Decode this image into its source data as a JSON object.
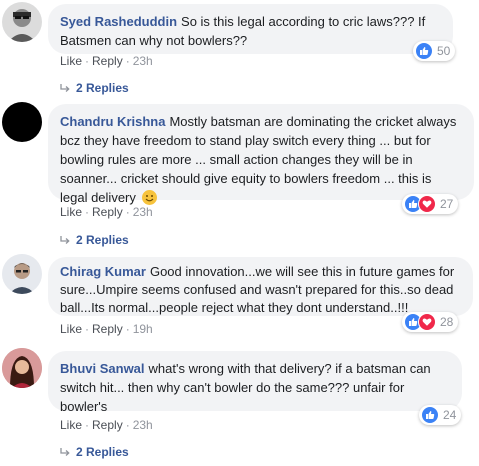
{
  "comments": [
    {
      "author": "Syed Rasheduddin",
      "text": "So is this legal according to cric laws??? If Batsmen can why not bowlers??",
      "like_label": "Like",
      "reply_label": "Reply",
      "time": "23h",
      "reaction_count": "50",
      "reactions": [
        "like-icon"
      ],
      "replies": "2 Replies"
    },
    {
      "author": "Chandru Krishna",
      "text": "Mostly batsman are dominating the cricket always bcz they have freedom to stand play switch every thing ... but for bowling rules are more ... small action changes they will be in soanner... cricket should give equity to bowlers freedom ... this is legal delivery",
      "like_label": "Like",
      "reply_label": "Reply",
      "time": "23h",
      "reaction_count": "27",
      "reactions": [
        "like-icon",
        "love-icon"
      ],
      "replies": "2 Replies"
    },
    {
      "author": "Chirag Kumar",
      "text": "Good innovation...we will see this in future games for sure...Umpire seems confused and wasn't prepared for this..so dead ball...Its normal...people reject what they dont understand..!!!",
      "like_label": "Like",
      "reply_label": "Reply",
      "time": "19h",
      "reaction_count": "28",
      "reactions": [
        "like-icon",
        "love-icon"
      ]
    },
    {
      "author": "Bhuvi Sanwal",
      "text": "what's wrong with that delivery? if a batsman can switch hit... then why can't bowler do the same??? unfair for bowler's",
      "like_label": "Like",
      "reply_label": "Reply",
      "time": "23h",
      "reaction_count": "24",
      "reactions": [
        "like-icon"
      ],
      "replies": "2 Replies"
    }
  ],
  "colors": {
    "author": "#385898",
    "bubble": "#f2f3f5",
    "like": "#3b82f6",
    "love": "#f0284a",
    "meta": "#90949c"
  }
}
